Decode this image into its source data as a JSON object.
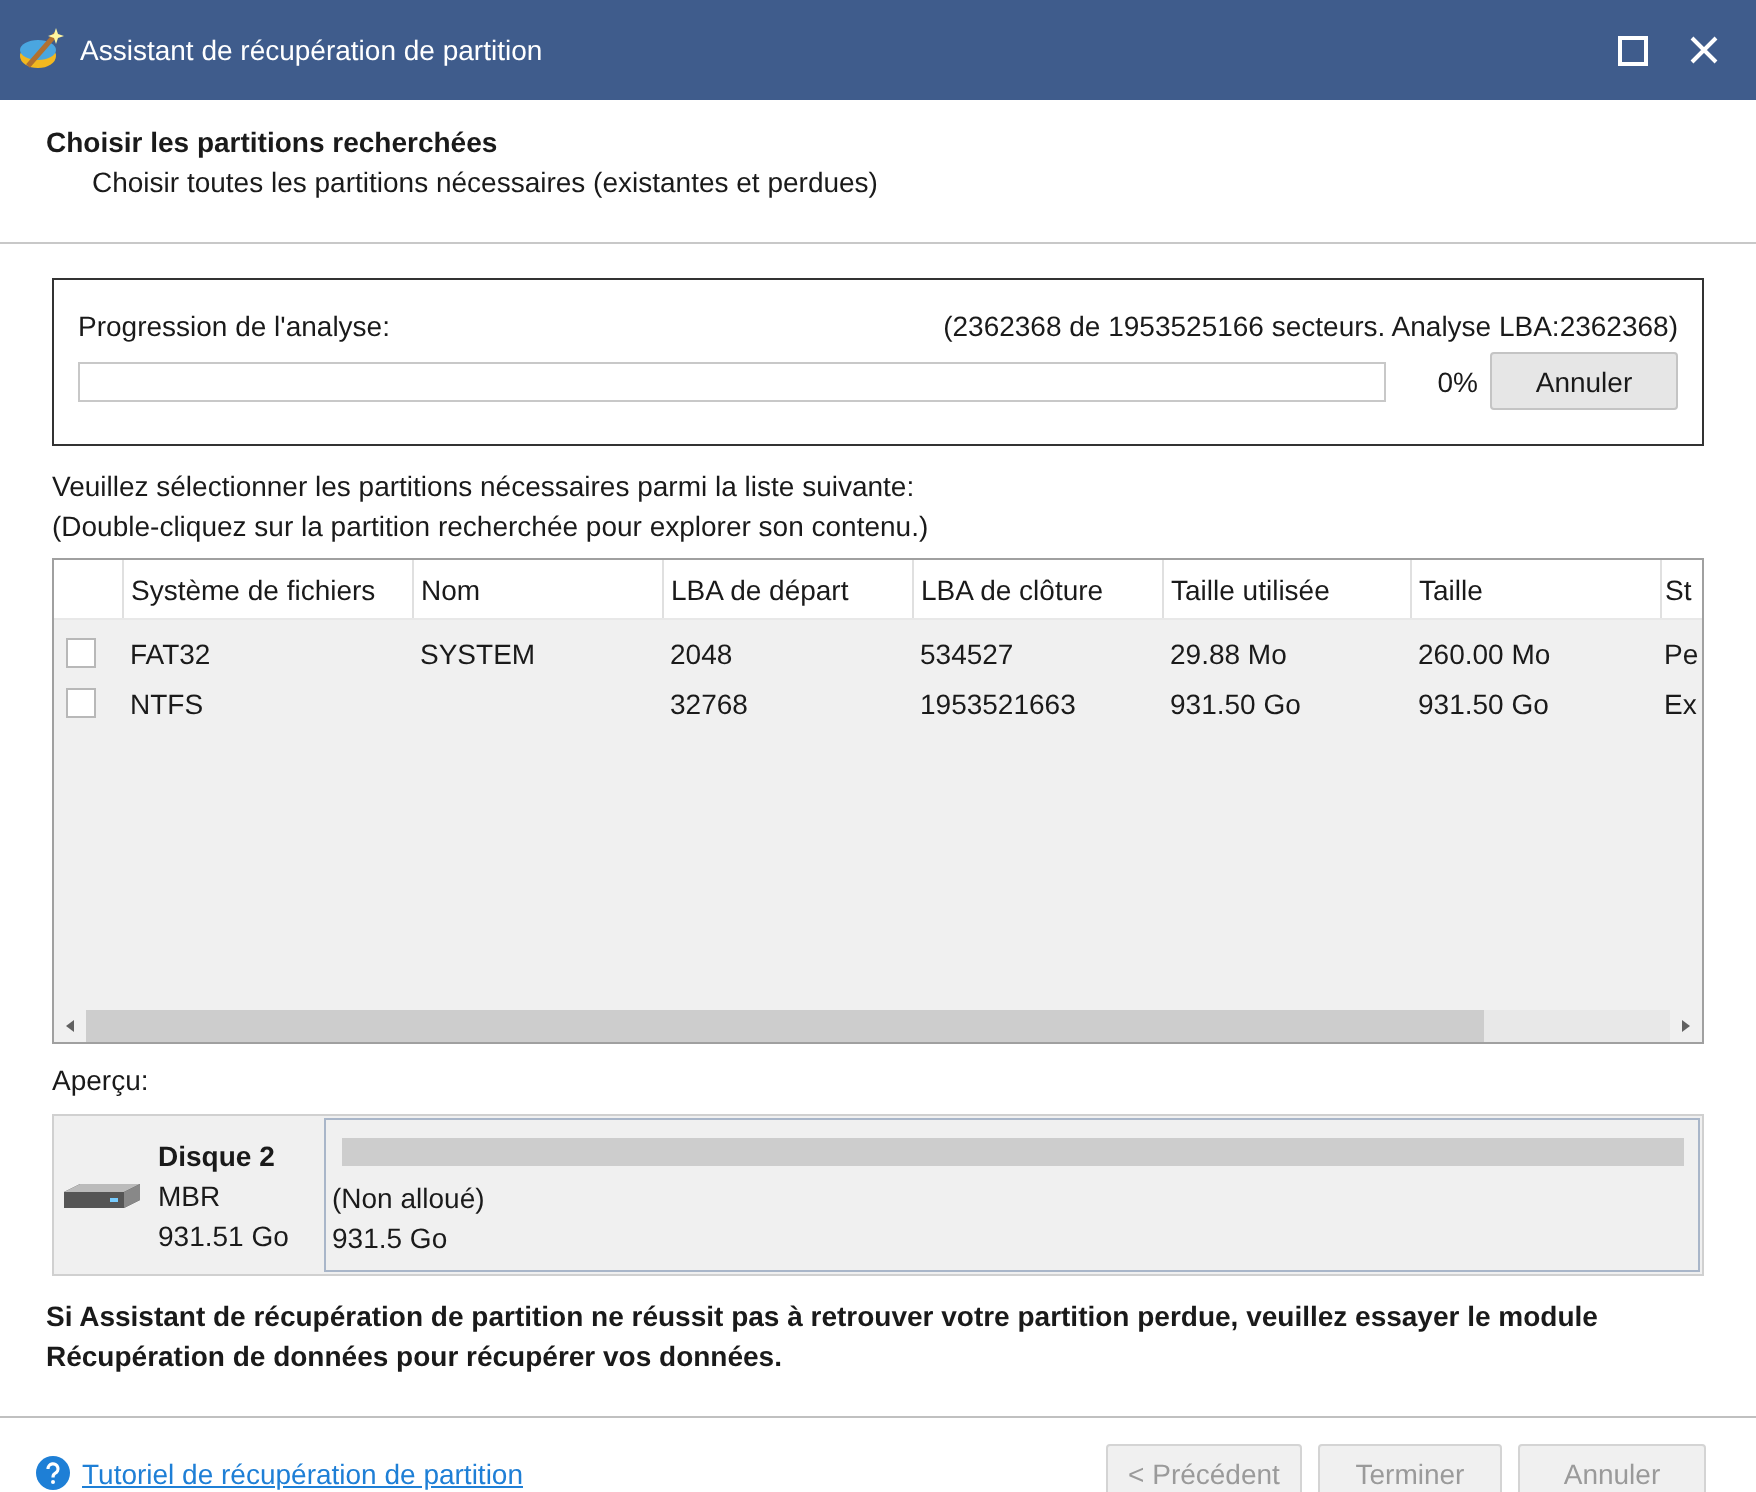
{
  "window": {
    "title": "Assistant de récupération de partition"
  },
  "header": {
    "title": "Choisir les partitions recherchées",
    "subtitle": "Choisir toutes les partitions nécessaires (existantes et perdues)"
  },
  "progress": {
    "label": "Progression de l'analyse:",
    "detail": "(2362368 de 1953525166 secteurs. Analyse LBA:2362368)",
    "level": 0,
    "percent": "0%",
    "cancel": "Annuler"
  },
  "instructions": [
    "Veuillez sélectionner les partitions nécessaires parmi la liste suivante:",
    "(Double-cliquez sur la partition recherchée pour explorer son contenu.)"
  ],
  "table": {
    "columns": [
      "Système de fichiers",
      "Nom",
      "LBA de départ",
      "LBA de clôture",
      "Taille utilisée",
      "Taille",
      "St"
    ],
    "rows": [
      {
        "checked": false,
        "cells": [
          "FAT32",
          "SYSTEM",
          "2048",
          "534527",
          "29.88 Mo",
          "260.00 Mo",
          "Pe"
        ]
      },
      {
        "checked": false,
        "cells": [
          "NTFS",
          "",
          "32768",
          "1953521663",
          "931.50 Go",
          "931.50 Go",
          "Ex"
        ]
      }
    ]
  },
  "preview": {
    "label": "Aperçu:",
    "disk": {
      "name": "Disque 2",
      "type": "MBR",
      "size": "931.51 Go"
    },
    "partitions": [
      {
        "label": "(Non alloué)",
        "size": "931.5 Go"
      }
    ]
  },
  "notice": "Si Assistant de récupération de partition ne réussit pas à retrouver votre partition perdue, veuillez essayer le module Récupération de données pour récupérer vos données.",
  "footer": {
    "link": "Tutoriel de récupération de partition",
    "buttons": [
      {
        "label": "< Précédent",
        "disabled": true
      },
      {
        "label": "Terminer",
        "disabled": true
      },
      {
        "label": "Annuler",
        "disabled": true
      }
    ]
  }
}
